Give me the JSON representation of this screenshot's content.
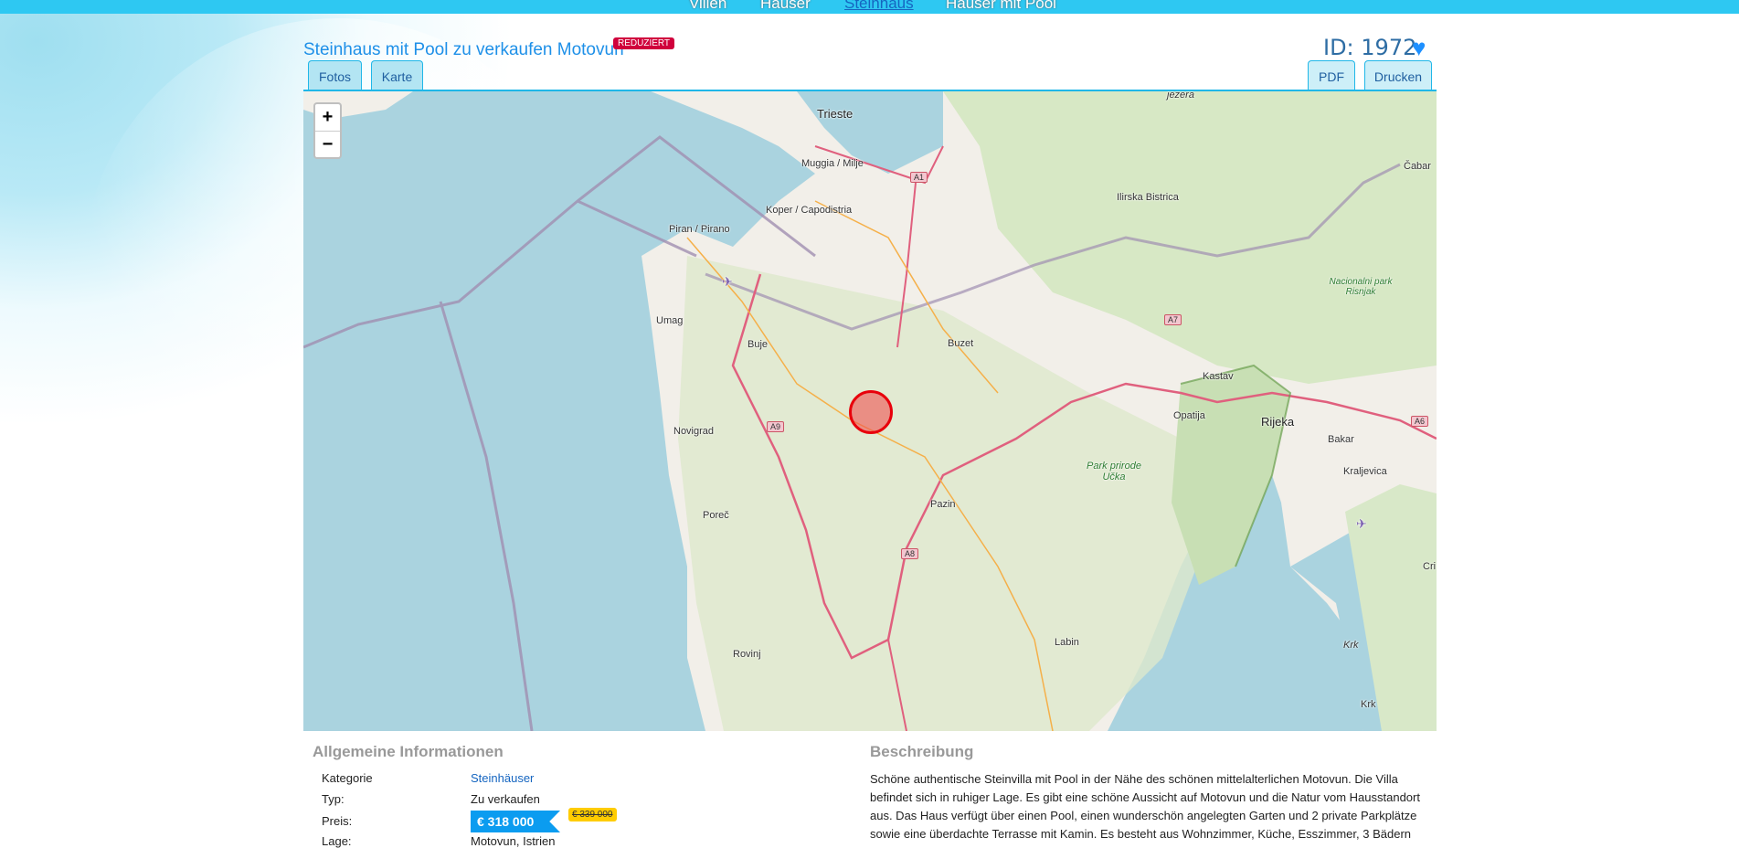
{
  "nav": {
    "items": [
      "Villen",
      "Häuser",
      "Steinhaus",
      "Häuser mit Pool"
    ],
    "active": "Steinhaus"
  },
  "header": {
    "title": "Steinhaus mit Pool zu verkaufen Motovun",
    "badge": "REDUZIERT",
    "id_label": "ID: 1972",
    "favorite_icon": "heart-icon"
  },
  "tabs": {
    "left": [
      "Fotos",
      "Karte"
    ],
    "right": [
      "PDF",
      "Drucken"
    ]
  },
  "map": {
    "zoom_in": "+",
    "zoom_out": "−",
    "labels": [
      "Trieste",
      "Muggia / Milje",
      "Koper / Capodistria",
      "Piran / Pirano",
      "Umag",
      "Buje",
      "Buzet",
      "Novigrad",
      "Poreč",
      "Pazin",
      "Rovinj",
      "Labin",
      "Opatija",
      "Rijeka",
      "Kastav",
      "Ilirska Bistrica",
      "Čabar",
      "Nacionalni park Risnjak",
      "Park prirode Učka",
      "Bakar",
      "Kraljevica",
      "Krk",
      "Krk",
      "jezera",
      "Cri"
    ],
    "roads": [
      "A1",
      "A7",
      "A9",
      "A8",
      "A6"
    ]
  },
  "info": {
    "heading": "Allgemeine Informationen",
    "rows": [
      {
        "label": "Kategorie",
        "value": "Steinhäuser"
      },
      {
        "label": "Typ:",
        "value": "Zu verkaufen"
      },
      {
        "label": "Preis:",
        "value": "€ 318 000",
        "old": "€ 339 000"
      },
      {
        "label": "Lage:",
        "value": "Motovun, Istrien"
      }
    ]
  },
  "description": {
    "heading": "Beschreibung",
    "text": "Schöne authentische Steinvilla mit Pool in der Nähe des schönen mittelalterlichen Motovun. Die Villa befindet sich in ruhiger Lage. Es gibt eine schöne Aussicht auf Motovun und die Natur vom Hausstandort aus. Das Haus verfügt über einen Pool, einen wunderschön angelegten Garten und 2 private Parkplätze sowie eine überdachte Terrasse mit Kamin. Es besteht aus Wohnzimmer, Küche, Esszimmer, 3 Bädern"
  },
  "colors": {
    "accent": "#20b7e8",
    "nav": "#2ec8f2",
    "badge": "#d0003c",
    "price": "#0b9cf0",
    "old_price": "#ffcc00"
  }
}
